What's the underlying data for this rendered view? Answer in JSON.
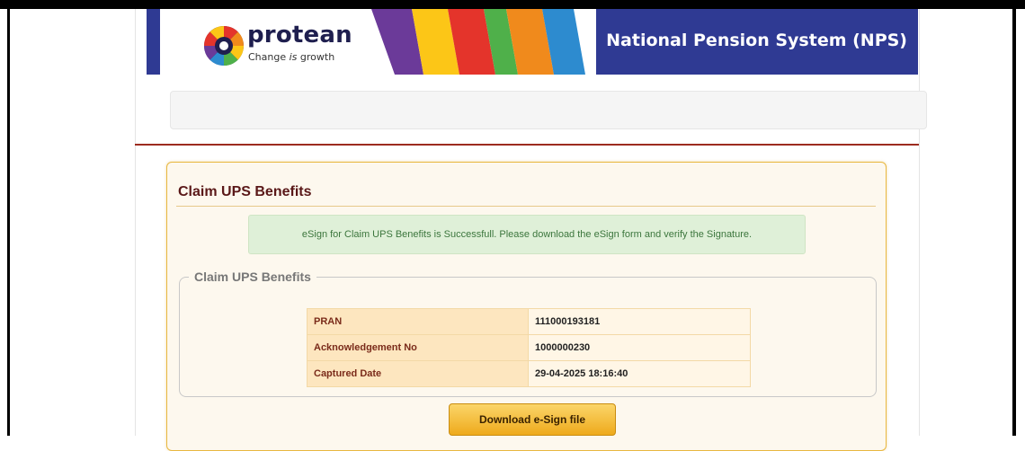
{
  "header": {
    "logo_text": "protean",
    "tagline_before": "Change ",
    "tagline_italic": "is",
    "tagline_after": " growth",
    "title": "National Pension System (NPS)",
    "colors": {
      "brand_blue": "#2f3a93",
      "divider_red": "#9c2b1f"
    }
  },
  "panel": {
    "title": "Claim UPS Benefits",
    "alert_message": "eSign for Claim UPS Benefits is Successfull. Please download the eSign form and verify the Signature.",
    "fieldset_legend": "Claim UPS Benefits",
    "rows": [
      {
        "label": "PRAN",
        "value": "111000193181"
      },
      {
        "label": "Acknowledgement No",
        "value": "1000000230"
      },
      {
        "label": "Captured Date",
        "value": "29-04-2025 18:16:40"
      }
    ],
    "download_button": "Download e-Sign file"
  }
}
